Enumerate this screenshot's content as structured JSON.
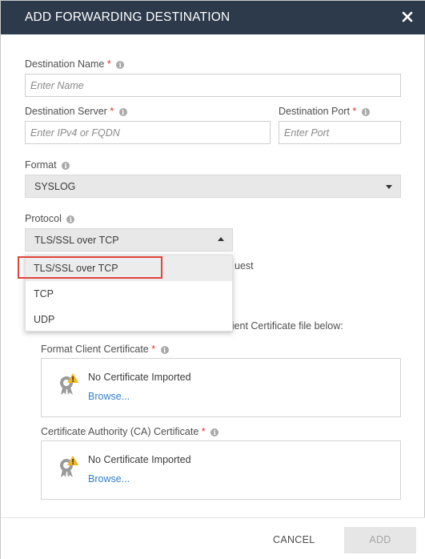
{
  "dialog": {
    "title": "ADD FORWARDING DESTINATION",
    "close_icon": "close-icon"
  },
  "fields": {
    "destination_name": {
      "label": "Destination Name",
      "required": "*",
      "placeholder": "Enter Name"
    },
    "destination_server": {
      "label": "Destination Server",
      "required": "*",
      "placeholder": "Enter IPv4 or FQDN"
    },
    "destination_port": {
      "label": "Destination Port",
      "required": "*",
      "placeholder": "Enter Port"
    },
    "format": {
      "label": "Format",
      "value": "SYSLOG"
    },
    "protocol": {
      "label": "Protocol",
      "value": "TLS/SSL over TCP",
      "options": [
        "TLS/SSL over TCP",
        "TCP",
        "UDP"
      ],
      "selected_index": 0
    }
  },
  "partial_text": {
    "behind_dropdown_1": "uest",
    "behind_dropdown_2": "lient Certificate file below:"
  },
  "certificates": {
    "client": {
      "label": "Format Client Certificate",
      "required": "*",
      "status": "No Certificate Imported",
      "browse": "Browse..."
    },
    "ca": {
      "label": "Certificate Authority (CA) Certificate",
      "required": "*",
      "status": "No Certificate Imported",
      "browse": "Browse..."
    }
  },
  "footer": {
    "cancel_label": "CANCEL",
    "add_label": "ADD"
  },
  "colors": {
    "header_bg": "#2d3a4b",
    "required": "#d9362b",
    "link": "#2f7fcf",
    "highlight": "#e0443b"
  }
}
